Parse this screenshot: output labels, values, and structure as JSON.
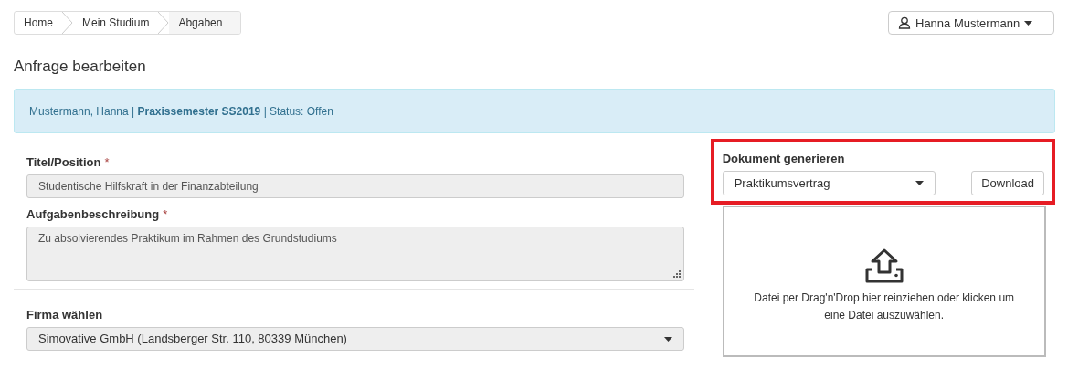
{
  "breadcrumb": [
    {
      "label": "Home",
      "selected": false
    },
    {
      "label": "Mein Studium",
      "selected": false
    },
    {
      "label": "Abgaben",
      "selected": true
    }
  ],
  "user_menu": {
    "label": "Hanna Mustermann"
  },
  "page_title": "Anfrage bearbeiten",
  "info_alert": "Mustermann, Hanna | **Praxissemester SS2019** | Status: Offen",
  "form": {
    "fields": [
      {
        "kind": "input",
        "label": "Titel/Position",
        "required_mark": "*",
        "value": "Studentische Hilfskraft in der Finanzabteilung",
        "disabled": true
      },
      {
        "kind": "textarea",
        "label": "Aufgabenbeschreibung",
        "required_mark": "*",
        "value": "Zu absolvierendes Praktikum im Rahmen des Grundstudiums",
        "disabled": true
      }
    ],
    "company": {
      "kind": "select",
      "label": "Firma wählen",
      "value": "Simovative GmbH (Landsberger Str. 110, 80339 München)",
      "disabled": true
    }
  },
  "document_panel": {
    "highlighted": true,
    "title": "Dokument generieren",
    "template_select": "Praktikumsvertrag",
    "download_button": "Download"
  },
  "upload_zone": {
    "text": "Datei per Drag'n'Drop hier reinziehen oder klicken um eine Datei auszuwählen."
  }
}
